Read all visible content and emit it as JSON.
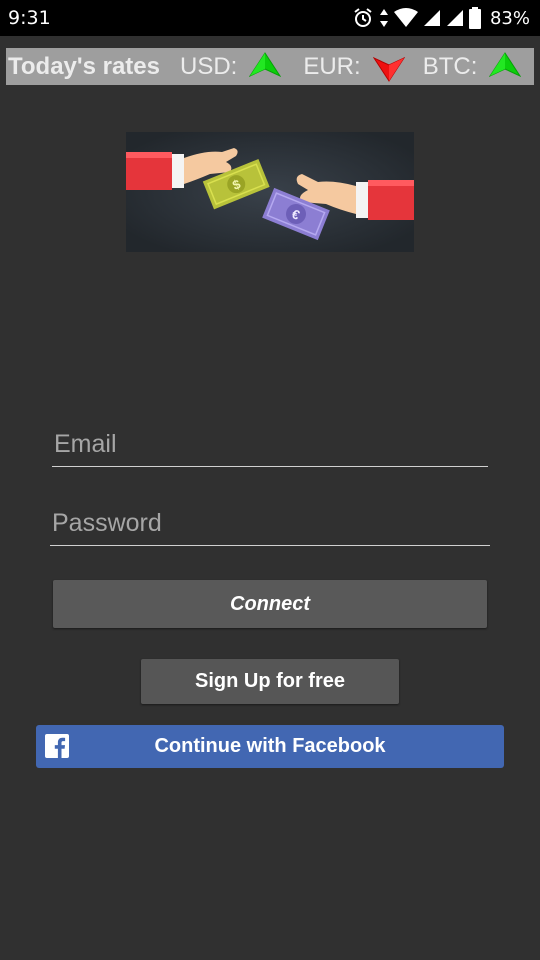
{
  "status_bar": {
    "time": "9:31",
    "battery": "83%",
    "icons": [
      "alarm-icon",
      "data-transfer-icon",
      "wifi-icon",
      "signal-icon",
      "signal-icon",
      "battery-icon"
    ]
  },
  "rates": {
    "title": "Today's rates",
    "items": [
      {
        "label": "USD:",
        "trend": "up",
        "color": "#0ccf0c"
      },
      {
        "label": "EUR:",
        "trend": "down",
        "color": "#ee1111"
      },
      {
        "label": "BTC:",
        "trend": "up",
        "color": "#0ccf0c"
      }
    ]
  },
  "banner": {
    "icons": [
      "dollar-bill-icon",
      "euro-bill-icon",
      "hand-icon"
    ]
  },
  "login": {
    "email_placeholder": "Email",
    "password_placeholder": "Password",
    "connect_label": "Connect",
    "signup_label": "Sign Up for free",
    "facebook_label": "Continue with Facebook",
    "facebook_color": "#4267b2"
  },
  "colors": {
    "background": "#303030",
    "rates_bar": "#9e9e9e",
    "button": "#595959"
  }
}
